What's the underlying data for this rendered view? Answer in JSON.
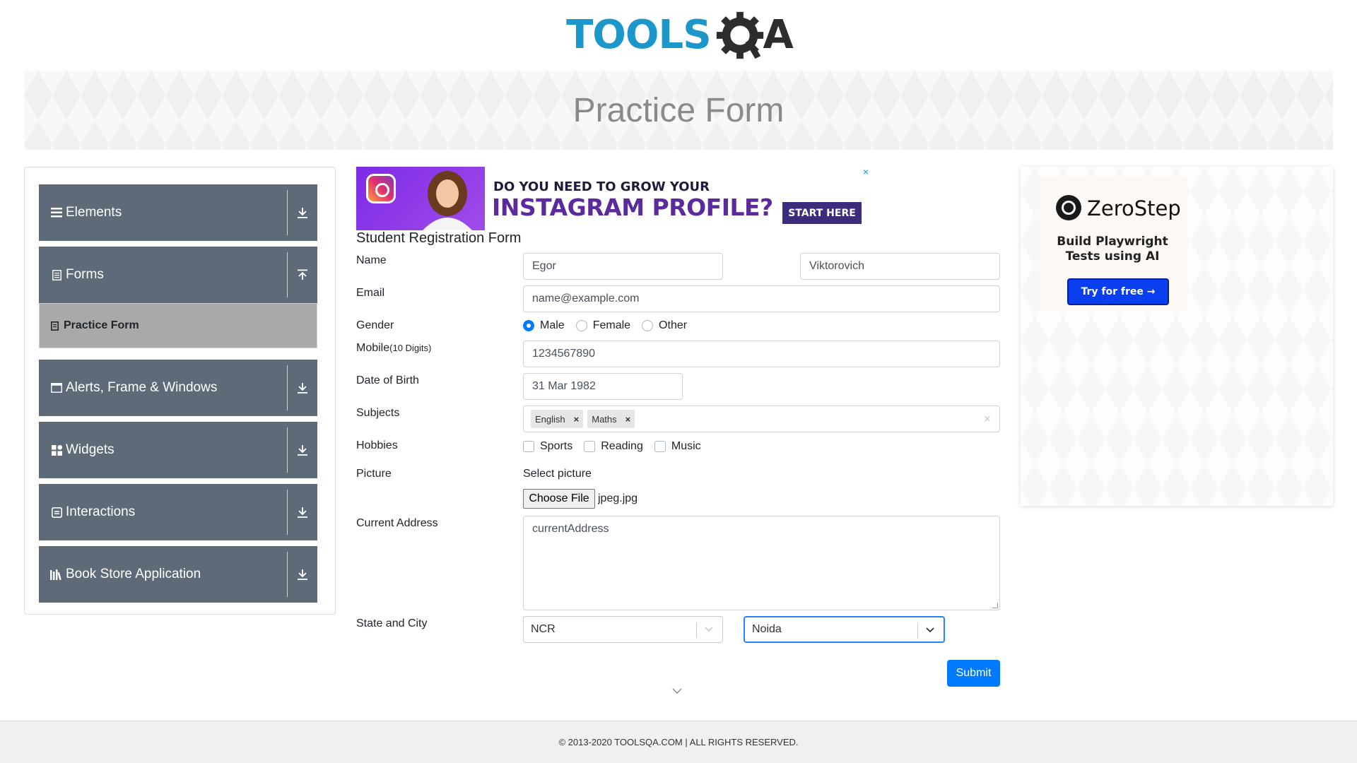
{
  "header": {
    "logo_tools": "TOOLS",
    "logo_qa": "A"
  },
  "banner": {
    "title": "Practice Form"
  },
  "sidebar": {
    "groups": [
      {
        "label": "Elements",
        "icon": "list-icon",
        "arrow": "download-icon"
      },
      {
        "label": "Forms",
        "icon": "document-icon",
        "arrow": "upload-icon"
      },
      {
        "label": "Alerts, Frame & Windows",
        "icon": "window-icon",
        "arrow": "download-icon"
      },
      {
        "label": "Widgets",
        "icon": "grid-icon",
        "arrow": "download-icon"
      },
      {
        "label": "Interactions",
        "icon": "interaction-icon",
        "arrow": "download-icon"
      },
      {
        "label": "Book Store Application",
        "icon": "books-icon",
        "arrow": "download-icon"
      }
    ],
    "active_item": {
      "label": "Practice Form",
      "icon": "file-icon"
    }
  },
  "ad_top": {
    "line1": "DO YOU NEED TO GROW YOUR",
    "line2": "INSTAGRAM PROFILE?",
    "button": "START HERE",
    "close": "×"
  },
  "form": {
    "title": "Student Registration Form",
    "labels": {
      "name": "Name",
      "email": "Email",
      "gender": "Gender",
      "mobile": "Mobile",
      "mobile_hint": "(10 Digits)",
      "dob": "Date of Birth",
      "subjects": "Subjects",
      "hobbies": "Hobbies",
      "picture": "Picture",
      "address": "Current Address",
      "state_city": "State and City"
    },
    "first_name": "Egor",
    "last_name": "Viktorovich",
    "email_placeholder": "name@example.com",
    "gender_options": [
      "Male",
      "Female",
      "Other"
    ],
    "gender_selected": "Male",
    "mobile": "1234567890",
    "dob": "31 Mar 1982",
    "subjects": [
      "English",
      "Maths"
    ],
    "subjects_clear": "×",
    "hobbies": [
      "Sports",
      "Reading",
      "Music"
    ],
    "picture_label": "Select picture",
    "file_button": "Choose File",
    "file_name": "jpeg.jpg",
    "address_placeholder": "currentAddress",
    "state": "NCR",
    "city": "Noida",
    "submit": "Submit"
  },
  "ad_right": {
    "brand": "ZeroStep",
    "tagline_1": "Build Playwright",
    "tagline_2": "Tests using AI",
    "button": "Try for free →"
  },
  "footer": {
    "text": "© 2013-2020 TOOLSQA.COM | ALL RIGHTS RESERVED."
  },
  "colors": {
    "sidebar_group": "#5f6a79",
    "active_item": "#a9a9a9",
    "primary": "#007bff",
    "logo_blue": "#1b97c9"
  }
}
